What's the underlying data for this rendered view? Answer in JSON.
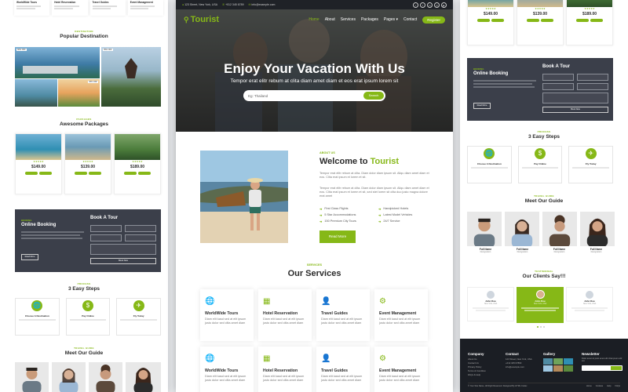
{
  "colors": {
    "accent": "#86b817",
    "dark": "#1f2227",
    "booking_bg": "#3b3f4a"
  },
  "left": {
    "top_tours": [
      {
        "title": "WorldWide Tours"
      },
      {
        "title": "Hotel Reservation"
      },
      {
        "title": "Travel Guides"
      },
      {
        "title": "Event Management"
      }
    ],
    "dest_sub": "DESTINATION",
    "dest_title": "Popular Destination",
    "dest_badges": [
      "30% OFF",
      "25% OFF",
      "35% OFF"
    ],
    "pkg_sub": "PACKAGES",
    "pkg_title": "Awesome Packages",
    "packages": [
      {
        "price": "$149.00"
      },
      {
        "price": "$139.00"
      },
      {
        "price": "$189.00"
      }
    ],
    "booking_sub": "BOOKING",
    "booking_title": "Online Booking",
    "booking_form_title": "Book A Tour",
    "booking_btn": "Read More",
    "booking_submit": "Book Now",
    "steps_sub": "PROCESS",
    "steps_title": "3 Easy Steps",
    "steps": [
      {
        "title": "Choose A Destination",
        "icon": "globe-icon"
      },
      {
        "title": "Pay Online",
        "icon": "dollar-icon"
      },
      {
        "title": "Fly Today",
        "icon": "plane-icon"
      }
    ],
    "guide_sub": "TRAVEL GUIDE",
    "guide_title": "Meet Our Guide"
  },
  "center": {
    "topbar": {
      "address": "123 Street, New York, USA",
      "phone": "+012 345 6789",
      "email": "info@example.com",
      "social": [
        "twitter-icon",
        "facebook-icon",
        "linkedin-icon",
        "instagram-icon",
        "youtube-icon"
      ],
      "social_glyphs": [
        "t",
        "f",
        "in",
        "◎",
        "▶"
      ]
    },
    "nav": {
      "logo": "Tourist",
      "items": [
        "Home",
        "About",
        "Services",
        "Packages",
        "Pages ▾",
        "Contact"
      ],
      "register": "Register"
    },
    "hero": {
      "title": "Enjoy Your Vacation With Us",
      "subtitle": "Tempor erat elitr rebum at clita diam amet diam et eos erat ipsum lorem sit",
      "search_placeholder": "Eg: Thailand",
      "search_btn": "Search"
    },
    "about": {
      "sub": "ABOUT US",
      "title_prefix": "Welcome to ",
      "title_accent": "Tourist",
      "p1": "Tempor erat elitr rebum at clita. Diam dolor diam ipsum sit. Aliqu diam amet diam et eos. Clita erat ipsum et lorem et sit.",
      "p2": "Tempor erat elitr rebum at clita. Diam dolor diam ipsum sit. Aliqu diam amet diam et eos. Clita erat ipsum et lorem et sit, sed stet lorem sit clita duo justo magna dolore erat amet",
      "features": [
        "First Class Flights",
        "Handpicked Hotels",
        "5 Star Accommodations",
        "Latest Model Vehicles",
        "150 Premium City Tours",
        "24/7 Service"
      ],
      "button": "Read More"
    },
    "services": {
      "sub": "SERVICES",
      "title": "Our Services",
      "items": [
        {
          "title": "WorldWide Tours",
          "desc": "Diam elit kasd sed at elit ipsum justo dolor sed clita amet diam",
          "icon": "globe-icon"
        },
        {
          "title": "Hotel Reservation",
          "desc": "Diam elit kasd sed at elit ipsum justo dolor sed clita amet diam",
          "icon": "hotel-icon"
        },
        {
          "title": "Travel Guides",
          "desc": "Diam elit kasd sed at elit ipsum justo dolor sed clita amet diam",
          "icon": "user-icon"
        },
        {
          "title": "Event Management",
          "desc": "Diam elit kasd sed at elit ipsum justo dolor sed clita amet diam",
          "icon": "cog-icon"
        },
        {
          "title": "WorldWide Tours",
          "desc": "Diam elit kasd sed at elit ipsum justo dolor sed clita amet diam",
          "icon": "globe-icon"
        },
        {
          "title": "Hotel Reservation",
          "desc": "Diam elit kasd sed at elit ipsum justo dolor sed clita amet diam",
          "icon": "hotel-icon"
        },
        {
          "title": "Travel Guides",
          "desc": "Diam elit kasd sed at elit ipsum justo dolor sed clita amet diam",
          "icon": "user-icon"
        },
        {
          "title": "Event Management",
          "desc": "Diam elit kasd sed at elit ipsum justo dolor sed clita amet diam",
          "icon": "cog-icon"
        }
      ]
    }
  },
  "right": {
    "packages": [
      {
        "price": "$149.00"
      },
      {
        "price": "$139.00"
      },
      {
        "price": "$189.00"
      }
    ],
    "booking_sub": "BOOKING",
    "booking_title": "Online Booking",
    "booking_form_title": "Book A Tour",
    "booking_btn": "Read More",
    "booking_submit": "Book Now",
    "steps_sub": "PROCESS",
    "steps_title": "3 Easy Steps",
    "steps": [
      {
        "title": "Choose A Destination",
        "icon": "globe-icon"
      },
      {
        "title": "Pay Online",
        "icon": "dollar-icon"
      },
      {
        "title": "Fly Today",
        "icon": "plane-icon"
      }
    ],
    "guide_sub": "TRAVEL GUIDE",
    "guide_title": "Meet Our Guide",
    "guides": [
      {
        "name": "Full Name",
        "role": "Designation"
      },
      {
        "name": "Full Name",
        "role": "Designation"
      },
      {
        "name": "Full Name",
        "role": "Designation"
      },
      {
        "name": "Full Name",
        "role": "Designation"
      }
    ],
    "clients_sub": "TESTIMONIAL",
    "clients_title": "Our Clients Say!!!",
    "clients": [
      {
        "name": "John Doe",
        "location": "New York, USA"
      },
      {
        "name": "John Doe",
        "location": "New York, USA"
      },
      {
        "name": "John Doe",
        "location": "New York, USA"
      }
    ],
    "footer": {
      "company_title": "Company",
      "company_links": [
        "About Us",
        "Contact Us",
        "Privacy Policy",
        "Terms & Condition",
        "FAQs & Help"
      ],
      "contact_title": "Contact",
      "contact_lines": [
        "123 Street, New York, USA",
        "+012 345 67890",
        "info@example.com"
      ],
      "gallery_title": "Gallery",
      "newsletter_title": "Newsletter",
      "newsletter_text": "Dolor amet sit justo amet elitr clita ipsum elitr est.",
      "copyright": "© Your Site Name, All Right Reserved. Designed By HTML Codex",
      "bottom_links": [
        "Home",
        "Cookies",
        "Help",
        "FAQs"
      ]
    }
  }
}
